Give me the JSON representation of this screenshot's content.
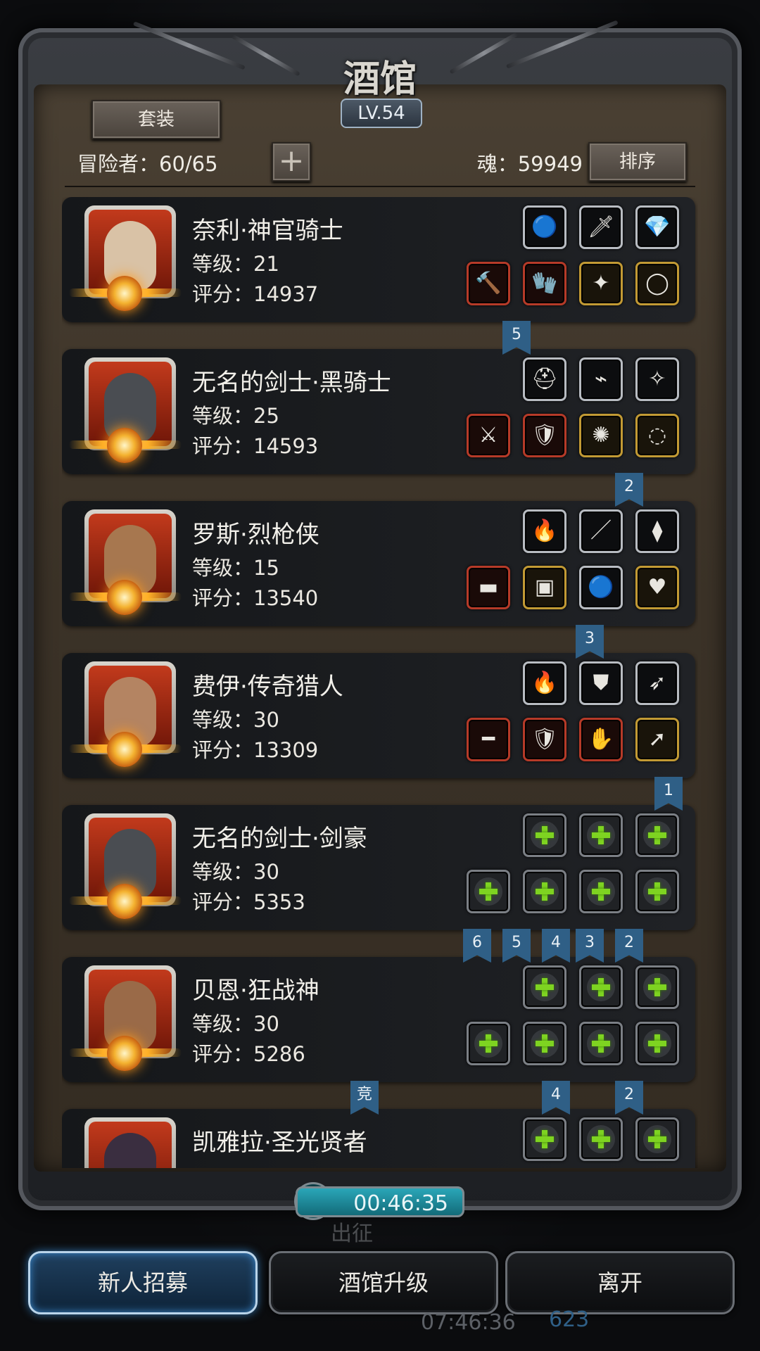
{
  "header": {
    "title": "酒馆",
    "level": "LV.54",
    "set_button": "套装",
    "adventurers": "冒险者：60/65",
    "add_button": "+",
    "soul": "魂：59949",
    "sort_button": "排序"
  },
  "heroes": [
    {
      "name": "奈利·神官骑士",
      "level": "等级：21",
      "score": "评分：14937",
      "top": [
        "orb-icon",
        "dagger-icon",
        "gem-icon"
      ],
      "bottom": [
        "hammer-icon",
        "glove-icon",
        "emerald-icon",
        "ring-icon"
      ]
    },
    {
      "name": "无名的剑士·黑骑士",
      "level": "等级：25",
      "score": "评分：14593",
      "top": [
        "helmet-icon",
        "bracer-icon",
        "amulet-icon"
      ],
      "bottom": [
        "sword-icon",
        "armor-icon",
        "beetle-icon",
        "necklace-icon"
      ]
    },
    {
      "name": "罗斯·烈枪侠",
      "level": "等级：15",
      "score": "评分：13540",
      "top": [
        "fire-icon",
        "staff-icon",
        "pendant-icon"
      ],
      "bottom": [
        "gun-icon",
        "chestplate-icon",
        "orb-icon",
        "heart-icon"
      ]
    },
    {
      "name": "费伊·传奇猎人",
      "level": "等级：30",
      "score": "评分：13309",
      "top": [
        "fire-icon",
        "shield-icon",
        "feather-icon"
      ],
      "bottom": [
        "rifle-icon",
        "armor-icon",
        "gauntlet-icon",
        "arm-icon"
      ]
    },
    {
      "name": "无名的剑士·剑豪",
      "level": "等级：30",
      "score": "评分：5353",
      "top": [
        "add-slot-icon",
        "add-slot-icon",
        "add-slot-icon"
      ],
      "bottom": [
        "add-slot-icon",
        "add-slot-icon",
        "add-slot-icon",
        "add-slot-icon"
      ]
    },
    {
      "name": "贝恩·狂战神",
      "level": "等级：30",
      "score": "评分：5286",
      "top": [
        "add-slot-icon",
        "add-slot-icon",
        "add-slot-icon"
      ],
      "bottom": [
        "add-slot-icon",
        "add-slot-icon",
        "add-slot-icon",
        "add-slot-icon"
      ]
    },
    {
      "name": "凯雅拉·圣光贤者",
      "level": "",
      "score": "",
      "top": [
        "add-slot-icon",
        "add-slot-icon",
        "add-slot-icon"
      ],
      "bottom": []
    }
  ],
  "ribbons": [
    {
      "text": "5"
    },
    {
      "text": "2"
    },
    {
      "text": "3"
    },
    {
      "text": "1"
    },
    {
      "text": "6"
    },
    {
      "text": "5"
    },
    {
      "text": "4"
    },
    {
      "text": "3"
    },
    {
      "text": "2"
    },
    {
      "text": "竞"
    },
    {
      "text": "4"
    },
    {
      "text": "2"
    }
  ],
  "footer": {
    "timer": "00:46:35",
    "faded_label": "出征",
    "clock": "07:46:36",
    "resource": "623",
    "recruit_button": "新人招募",
    "upgrade_button": "酒馆升级",
    "leave_button": "离开"
  },
  "colors": {
    "accent_blue": "#2f5f86",
    "slot_red": "#b63a28",
    "slot_gold": "#c29a34",
    "plus_green": "#7ed321"
  }
}
